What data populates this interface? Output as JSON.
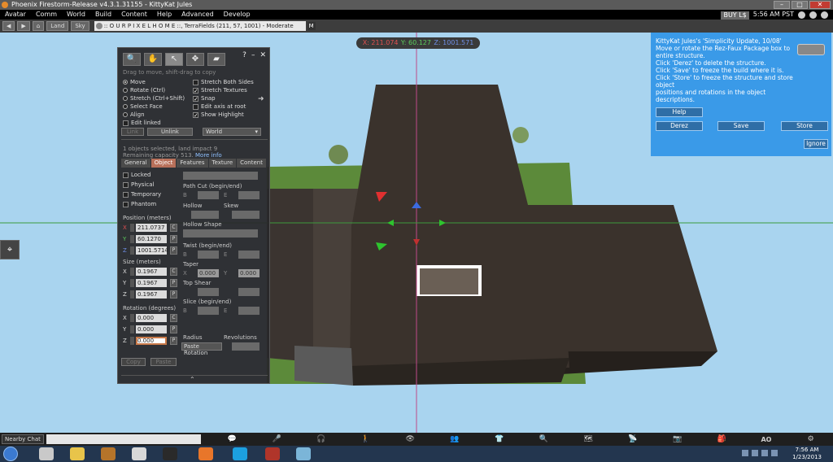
{
  "window": {
    "title": "Phoenix Firestorm-Release v4.3.1.31155 - KittyKat Jules",
    "controls": [
      "–",
      "□",
      "✕"
    ]
  },
  "menu": {
    "items": [
      "Avatar",
      "Comm",
      "World",
      "Build",
      "Content",
      "Help",
      "Advanced",
      "Develop"
    ],
    "buy": "BUY L$",
    "time": "5:56 AM PST"
  },
  "nav": {
    "back": "◀",
    "forward": "▶",
    "home": "⌂",
    "land": "Land",
    "sky": "Sky",
    "location": ":: O U R P I X E L H O M E ::, TerraFields (211, 57, 1001) - Moderate",
    "rating": "M"
  },
  "coords": {
    "x": "X: 211.074",
    "y": "Y: 60.127",
    "z": "Z: 1001.571"
  },
  "build": {
    "tool_icons": [
      "🔍",
      "✋",
      "↖",
      "✥",
      "▰"
    ],
    "window_controls": [
      "?",
      "–",
      "✕"
    ],
    "hint": "Drag to move, shift-drag to copy",
    "modes": [
      "Move",
      "Rotate (Ctrl)",
      "Stretch (Ctrl+Shift)",
      "Select Face",
      "Align",
      "Edit linked"
    ],
    "options": [
      {
        "label": "Stretch Both Sides",
        "checked": false
      },
      {
        "label": "Stretch Textures",
        "checked": true
      },
      {
        "label": "Snap",
        "checked": true
      },
      {
        "label": "Edit axis at root",
        "checked": false
      },
      {
        "label": "Show Highlight",
        "checked": true
      }
    ],
    "link": "Link",
    "unlink": "Unlink",
    "ruler": "World",
    "selection_info": "1 objects selected, land impact 9",
    "remaining": "Remaining capacity 513.",
    "more_info": "More info",
    "tabs": [
      "General",
      "Object",
      "Features",
      "Texture",
      "Content"
    ],
    "flags": [
      "Locked",
      "Physical",
      "Temporary",
      "Phantom"
    ],
    "position_label": "Position (meters)",
    "position": [
      "211.0737",
      "60.1270",
      "1001.5714"
    ],
    "size_label": "Size (meters)",
    "size": [
      "0.1967",
      "0.1967",
      "0.1967"
    ],
    "rotation_label": "Rotation (degrees)",
    "rotation": [
      "0.000",
      "0.000",
      "0.000"
    ],
    "axes": [
      "X",
      "Y",
      "Z"
    ],
    "cp": [
      "C",
      "P"
    ],
    "copy": "Copy",
    "paste": "Paste",
    "paste_rotation": "Paste Rotation",
    "path_cut": "Path Cut (begin/end)",
    "hollow": "Hollow",
    "skew": "Skew",
    "hollow_shape": "Hollow Shape",
    "twist": "Twist (begin/end)",
    "taper": "Taper",
    "taper_values": [
      "0.000",
      "0.000"
    ],
    "top_shear": "Top Shear",
    "slice": "Slice (begin/end)",
    "radius": "Radius",
    "revolutions": "Revolutions",
    "be": [
      "B",
      "E"
    ],
    "expand": "⌃"
  },
  "dialog": {
    "lines": [
      "KittyKat Jules's 'Simplicity Update, 10/08'",
      "Move or rotate the Rez-Faux Package box to",
      "entire structure.",
      "Click 'Derez' to delete the structure.",
      "Click 'Save' to freeze the build where it is.",
      "Click 'Store' to freeze the structure and store object",
      "positions and rotations in the object descriptions."
    ],
    "help": "Help",
    "derez": "Derez",
    "save": "Save",
    "store": "Store",
    "ignore": "Ignore"
  },
  "bottom": {
    "nearby_chat": "Nearby Chat",
    "icons": [
      "💬",
      "🎤",
      "🎧",
      "🚶",
      "👁",
      "👥",
      "👕",
      "🔍",
      "🗺",
      "📡",
      "📷",
      "🎒",
      "AO",
      "⚙"
    ]
  },
  "taskbar": {
    "time": "7:56 AM",
    "date": "1/23/2013"
  },
  "colors": {
    "sky": "#a9d4ef",
    "wood": "#3a322c",
    "dialog": "#3a9ae8",
    "active_tab": "#b8705a"
  }
}
